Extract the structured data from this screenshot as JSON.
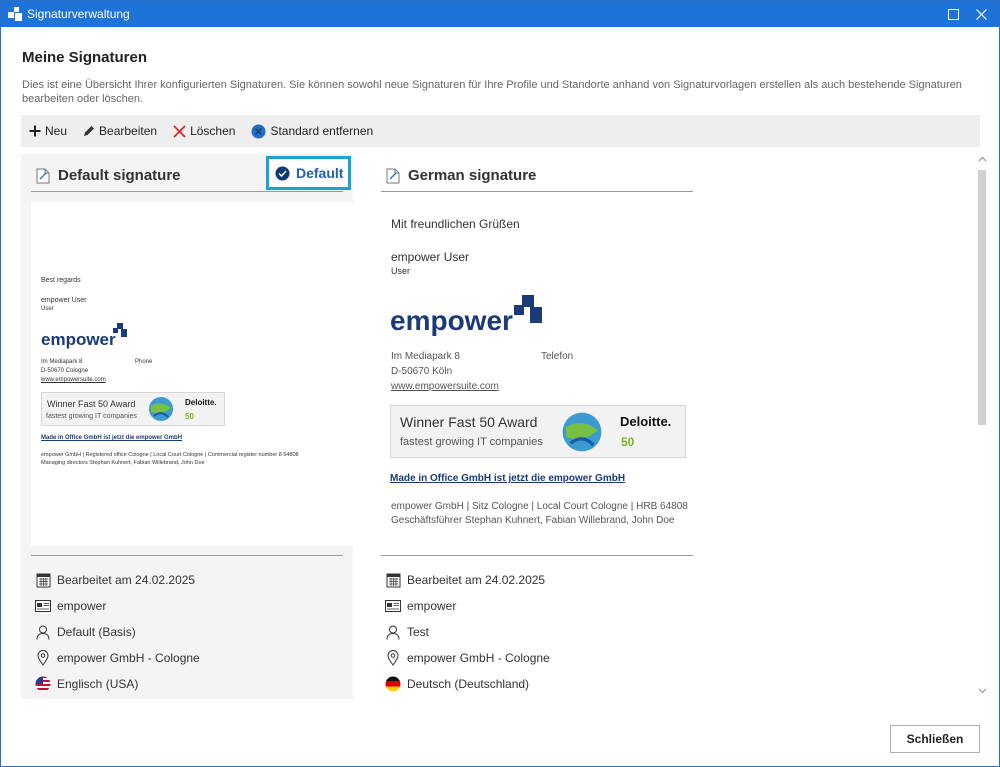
{
  "window": {
    "title": "Signaturverwaltung"
  },
  "page": {
    "heading": "Meine Signaturen",
    "description": "Dies ist eine Übersicht Ihrer konfigurierten Signaturen. Sie können sowohl neue Signaturen für Ihre Profile und Standorte anhand von Signaturvorlagen erstellen als auch bestehende Signaturen bearbeiten oder löschen."
  },
  "toolbar": {
    "new_label": "Neu",
    "edit_label": "Bearbeiten",
    "delete_label": "Löschen",
    "remove_default_label": "Standard entfernen"
  },
  "signatures": [
    {
      "title": "Default signature",
      "is_default": true,
      "badge_label": "Default",
      "preview": {
        "greeting": "Best regards",
        "name": "empower User",
        "role": "User",
        "logo": "empower",
        "address_line1": "Im Mediapark 8",
        "phone_label": "Phone",
        "address_line2": "D-50670 Cologne",
        "website": "www.empowersuite.com",
        "award_title": "Winner Fast 50 Award",
        "award_subtitle": "fastest growing IT companies",
        "award_brand": "Deloitte.",
        "award_number": "50",
        "link_text": "Made in Office GmbH ist jetzt die empower GmbH",
        "legal_line1": "empower GmbH | Registered office Cologne | Local Court Cologne | Commercial register number 8 64808",
        "legal_line2": "Managing directors Stephan Kuhnert, Fabian Willebrand, John Doe"
      },
      "info": {
        "edited": "Bearbeitet am 24.02.2025",
        "template": "empower",
        "profile": "Default (Basis)",
        "location": "empower GmbH - Cologne",
        "language": "Englisch (USA)"
      }
    },
    {
      "title": "German signature",
      "is_default": false,
      "preview": {
        "greeting": "Mit freundlichen Grüßen",
        "name": "empower User",
        "role": "User",
        "logo": "empower",
        "address_line1": "Im Mediapark 8",
        "phone_label": "Telefon",
        "address_line2": "D-50670 Köln",
        "website": "www.empowersuite.com",
        "award_title": "Winner Fast 50 Award",
        "award_subtitle": "fastest growing IT companies",
        "award_brand": "Deloitte.",
        "award_number": "50",
        "link_text": "Made in Office GmbH ist jetzt die empower GmbH",
        "legal_line1": "empower GmbH | Sitz Cologne | Local Court Cologne | HRB 64808",
        "legal_line2": "Geschäftsführer Stephan Kuhnert, Fabian Willebrand, John Doe"
      },
      "info": {
        "edited": "Bearbeitet am 24.02.2025",
        "template": "empower",
        "profile": "Test",
        "location": "empower GmbH - Cologne",
        "language": "Deutsch (Deutschland)"
      }
    }
  ],
  "footer": {
    "close_label": "Schließen"
  },
  "colors": {
    "titlebar": "#1e73d9",
    "accent": "#1aa3d6",
    "brand": "#1b3b78"
  },
  "icons": [
    "app-icon",
    "maximize-icon",
    "close-icon",
    "plus-icon",
    "pencil-icon",
    "delete-x-icon",
    "check-circle-icon",
    "document-icon",
    "calendar-icon",
    "card-icon",
    "user-icon",
    "location-pin-icon",
    "flag-us-icon",
    "flag-de-icon",
    "chevron-up-icon",
    "chevron-down-icon"
  ]
}
